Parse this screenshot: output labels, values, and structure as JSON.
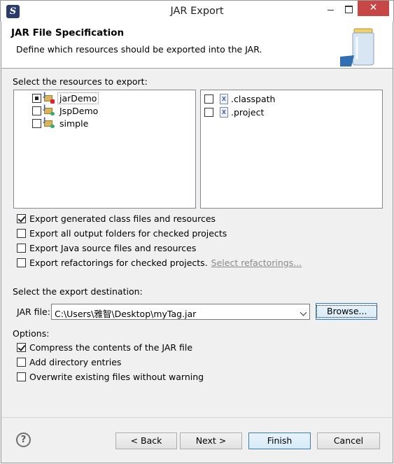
{
  "window": {
    "title": "JAR Export",
    "close_glyph": "✕"
  },
  "header": {
    "title": "JAR File Specification",
    "description": "Define which resources should be exported into the JAR."
  },
  "resources": {
    "label": "Select the resources to export:",
    "projects": [
      {
        "name": "jarDemo",
        "state": "partial",
        "icon": "java-project-icon"
      },
      {
        "name": "JspDemo",
        "state": "unchecked",
        "icon": "java-project-icon"
      },
      {
        "name": "simple",
        "state": "unchecked",
        "icon": "java-project-icon"
      }
    ],
    "files": [
      {
        "name": ".classpath",
        "state": "unchecked",
        "icon": "xml-file-icon"
      },
      {
        "name": ".project",
        "state": "unchecked",
        "icon": "xml-file-icon"
      }
    ]
  },
  "options_top": [
    {
      "label": "Export generated class files and resources",
      "checked": true
    },
    {
      "label": "Export all output folders for checked projects",
      "checked": false
    },
    {
      "label": "Export Java source files and resources",
      "checked": false
    },
    {
      "label": "Export refactorings for checked projects.",
      "checked": false,
      "link": "Select refactorings..."
    }
  ],
  "destination": {
    "label": "Select the export destination:",
    "jar_file_label": "JAR file:",
    "jar_file_value": "C:\\Users\\雅智\\Desktop\\myTag.jar",
    "browse_label": "Browse..."
  },
  "options": {
    "label": "Options:",
    "items": [
      {
        "label": "Compress the contents of the JAR file",
        "checked": true
      },
      {
        "label": "Add directory entries",
        "checked": false
      },
      {
        "label": "Overwrite existing files without warning",
        "checked": false
      }
    ]
  },
  "footer": {
    "help_glyph": "?",
    "back_label": "< Back",
    "next_label": "Next >",
    "finish_label": "Finish",
    "cancel_label": "Cancel"
  },
  "colors": {
    "accent": "#3c7fb1",
    "close": "#c74747"
  }
}
